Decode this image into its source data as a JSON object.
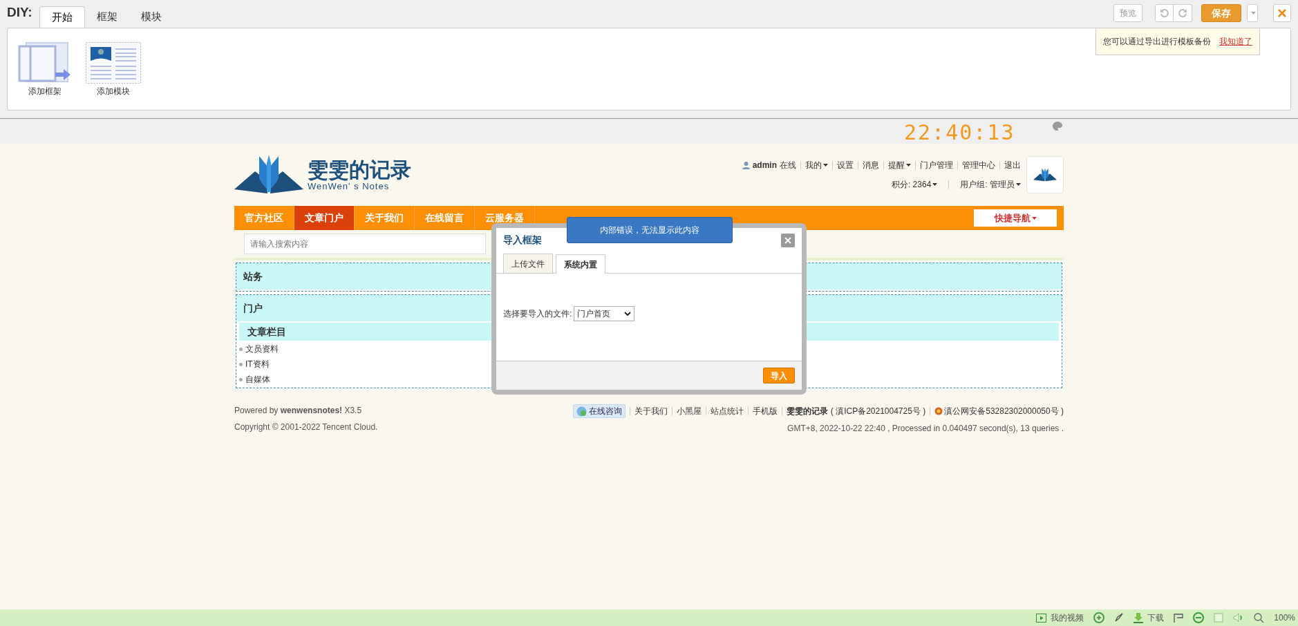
{
  "diy": {
    "title": "DIY:",
    "tabs": [
      {
        "label": "开始",
        "selected": true
      },
      {
        "label": "框架",
        "selected": false
      },
      {
        "label": "模块",
        "selected": false
      }
    ],
    "tools": [
      {
        "kind": "frame",
        "label": "添加框架"
      },
      {
        "kind": "module",
        "label": "添加模块"
      }
    ],
    "buttons": {
      "preview": "预览",
      "save": "保存"
    },
    "tip": {
      "text": "您可以通过导出进行模板备份",
      "link": "我知道了"
    }
  },
  "clock": "22:40:13",
  "site": {
    "logo_title": "雯雯的记录",
    "logo_subtitle": "WenWen' s Notes",
    "user": {
      "name": "admin",
      "status": "在线",
      "links": [
        {
          "label": "我的",
          "menu": true
        },
        {
          "label": "设置",
          "menu": false
        },
        {
          "label": "消息",
          "menu": false
        },
        {
          "label": "提醒",
          "menu": true
        },
        {
          "label": "门户管理",
          "menu": false
        },
        {
          "label": "管理中心",
          "menu": false
        },
        {
          "label": "退出",
          "menu": false
        }
      ],
      "points": "积分: 2364",
      "group": "用户组: 管理员"
    },
    "nav": [
      {
        "label": "官方社区",
        "selected": false
      },
      {
        "label": "文章门户",
        "selected": true
      },
      {
        "label": "关于我们",
        "selected": false
      },
      {
        "label": "在线留言",
        "selected": false
      },
      {
        "label": "云服务器",
        "selected": false
      }
    ],
    "quick_nav": "快捷导航",
    "search": {
      "placeholder": "请输入搜索内容"
    },
    "blocks": [
      {
        "title": "站务"
      },
      {
        "title": "门户",
        "subtitle": "文章栏目",
        "items": [
          "文员资料",
          "IT资料",
          "自媒体"
        ]
      }
    ]
  },
  "dialog": {
    "title": "导入框架",
    "tabs": [
      {
        "label": "上传文件",
        "selected": false
      },
      {
        "label": "系统内置",
        "selected": true
      }
    ],
    "field_label": "选择要导入的文件:",
    "select_value": "门户首页",
    "button": "导入",
    "error": "内部错误，无法显示此内容"
  },
  "footer": {
    "powered": "Powered by **wenwensnotes!** X3.5",
    "copyright": "Copyright © 2001-2022 Tencent Cloud.",
    "consult": "在线咨询",
    "links": [
      {
        "label": "关于我们",
        "kind": "link"
      },
      {
        "label": "小黑屋",
        "kind": "link"
      },
      {
        "label": "站点统计",
        "kind": "link"
      },
      {
        "label": "手机版",
        "kind": "link"
      },
      {
        "label": "**雯雯的记录** ( 滇ICP备2021004725号 )",
        "kind": "icp"
      },
      {
        "label": "滇公网安备53282302000050号 )",
        "kind": "police"
      }
    ],
    "stats": "GMT+8, 2022-10-22 22:40 , Processed in 0.040497 second(s), 13 queries ."
  },
  "status_bar": {
    "video": "我的视频",
    "download": "下载",
    "zoom": "100%"
  }
}
